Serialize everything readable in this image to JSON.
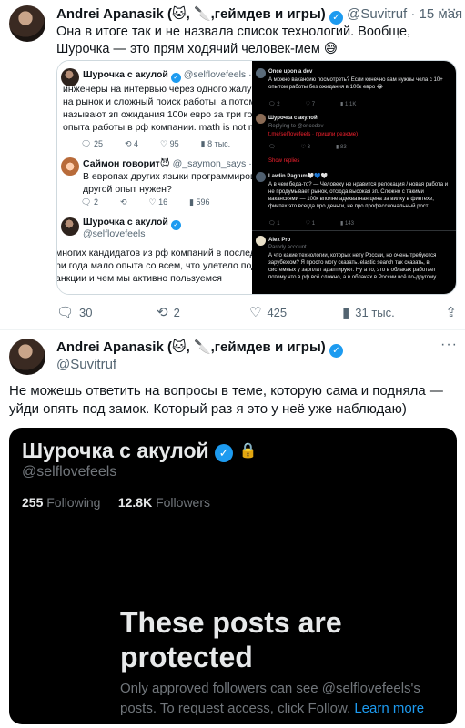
{
  "tweet1": {
    "author": "Andrei Apanasik (🐱, 🔪,геймдев и игры)",
    "handle": "@Suvitruf",
    "date": "· 15 мая",
    "text": "Она в итоге так и не назвала список технологий. Вообще, Шурочка — это прям ходячий человек-мем 😅",
    "stats": {
      "replies": "30",
      "retweets": "2",
      "likes": "425",
      "views": "31 тыс."
    },
    "media_left": {
      "post1": {
        "author": "Шурочка с акулой",
        "handle": "@selflovefeels · 3 ч",
        "lines": [
          "инженеры на интервью через одного жалуются",
          "на рынок и сложный поиск работы, а потом",
          "называют зп ожидания 100к евро за три года",
          "опыта работы в рф компании. math is not mathi"
        ],
        "stats": [
          "25",
          "4",
          "95",
          "8 тыс."
        ]
      },
      "post2": {
        "author": "Саймон говорит😈",
        "handle": "@_saymon_says · 3 ч",
        "lines": [
          "В европах других языки программирования и",
          "другой опыт нужен?"
        ],
        "stats": [
          "2",
          "",
          "16",
          "596"
        ]
      },
      "post3": {
        "author": "Шурочка с акулой",
        "handle": "@selflovefeels",
        "lines": [
          "многих кандидатов из рф компаний в последні",
          "ри года мало опыта со всем, что улетело под",
          "анкции и чем мы активно пользуемся"
        ]
      }
    },
    "media_right": {
      "p1": {
        "author": "Once upon a dev",
        "text": "А можно вакансию посмотреть? Если конечно вам нужны чела с 10+ опытом работы без ожидания в 100к евро 😂",
        "stats": [
          "2",
          "7",
          "1.1K"
        ]
      },
      "p2": {
        "author": "Шурочка с акулой",
        "text": "Replying to @oncedev",
        "text2": "t.me/selflovefeels · пришли резюме)",
        "stats": [
          "",
          "3",
          "83"
        ]
      },
      "show_replies": "Show replies",
      "p3": {
        "author": "Lawlin Pagrum🤍💙🤍",
        "text": "А в чем беда-то? — Человеку не нравится релокация / новая работа и не продумывает рынок, отсюда высокая зп. Сложно с такими вакансиями — 100к вполне адекватная цена за вилку в финтехе, финтех это всегда про деньги, не про профессиональный рост",
        "stats": [
          "1",
          "1",
          "143"
        ]
      },
      "p4": {
        "author": "Alex Pro",
        "sub": "Parody account",
        "text": "А что какие технологии, которых нету России, но очень требуются зарубежом? Я просто могу сказать. elastic search так сказать, в системных у зарплат адаптируют. Ну а то, это в облаках работает потому что в рф всё сложно, а в облаках в России всё по-другому."
      }
    }
  },
  "tweet2": {
    "author": "Andrei Apanasik (🐱, 🔪,геймдев и игры)",
    "handle": "@Suvitruf",
    "text": "Не можешь ответить на вопросы в теме, которую сама и подняла — уйди опять под замок. Который раз я это у неё уже наблюдаю)",
    "media": {
      "name": "Шурочка с акулой",
      "handle": "@selflovefeels",
      "following_count": "255",
      "following_label": "Following",
      "followers_count": "12.8K",
      "followers_label": "Followers",
      "title": "These posts are protected",
      "subtitle": "Only approved followers can see @selflovefeels's posts. To request access, click Follow.",
      "learn_more": "Learn more"
    }
  },
  "colors": {
    "accent": "#1d9bf0",
    "muted": "#536471",
    "dark_bg": "#000000"
  }
}
